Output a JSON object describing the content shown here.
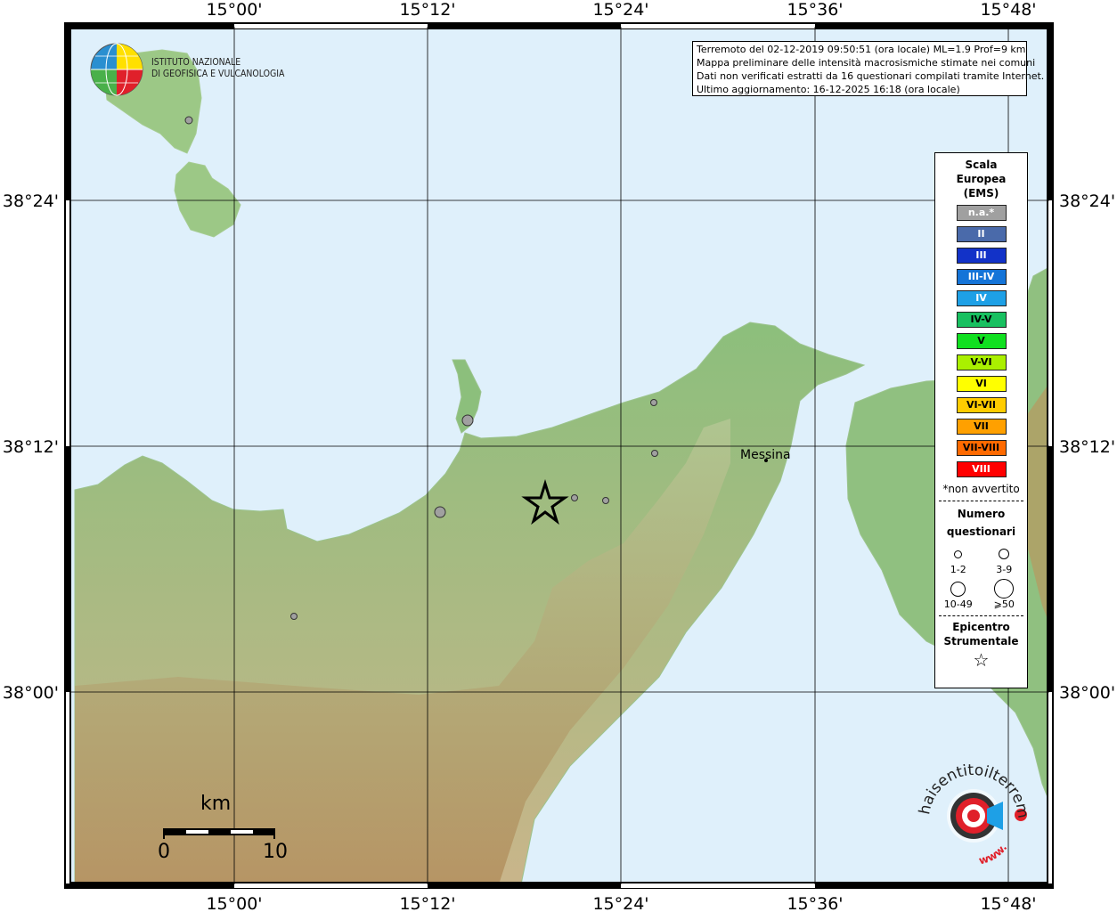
{
  "map": {
    "lon_ticks": [
      "15°00'",
      "15°12'",
      "15°24'",
      "15°36'",
      "15°48'"
    ],
    "lat_ticks": [
      "38°24'",
      "38°12'",
      "38°00'"
    ],
    "city": "Messina"
  },
  "info": {
    "line1": "Terremoto del 02-12-2019 09:50:51 (ora locale) ML=1.9 Prof=9 km",
    "line2": "Mappa preliminare delle intensità macrosismiche stimate nei comuni",
    "line3": "Dati non verificati estratti da 16 questionari compilati tramite Internet.",
    "line4": "Ultimo aggiornamento: 16-12-2025 16:18 (ora locale)"
  },
  "logo": {
    "line1": "ISTITUTO NAZIONALE",
    "line2": "DI GEOFISICA E VULCANOLOGIA"
  },
  "legend": {
    "title_line1": "Scala",
    "title_line2": "Europea",
    "title_line3": "(EMS)",
    "ems": [
      {
        "label": "n.a.*",
        "color": "#a0a0a0"
      },
      {
        "label": "II",
        "color": "#4a6aaa"
      },
      {
        "label": "III",
        "color": "#1232c8"
      },
      {
        "label": "III-IV",
        "color": "#1474d8"
      },
      {
        "label": "IV",
        "color": "#1ea0e6"
      },
      {
        "label": "IV-V",
        "color": "#18c060"
      },
      {
        "label": "V",
        "color": "#10e020"
      },
      {
        "label": "V-VI",
        "color": "#aaf000"
      },
      {
        "label": "VI",
        "color": "#ffff00"
      },
      {
        "label": "VI-VII",
        "color": "#ffcc00"
      },
      {
        "label": "VII",
        "color": "#ffa000"
      },
      {
        "label": "VII-VIII",
        "color": "#ff6a00"
      },
      {
        "label": "VIII",
        "color": "#ff0000"
      }
    ],
    "note": "*non avvertito",
    "questionnaires_line1": "Numero",
    "questionnaires_line2": "questionari",
    "q_sizes": [
      "1-2",
      "3-9",
      "10-49",
      "⩾50"
    ],
    "epicenter_line1": "Epicentro",
    "epicenter_line2": "Strumentale"
  },
  "scale_bar": {
    "unit": "km",
    "start": "0",
    "end": "10"
  },
  "watermark": {
    "text": "haisentitoilterremoto.it",
    "prefix": "www."
  }
}
